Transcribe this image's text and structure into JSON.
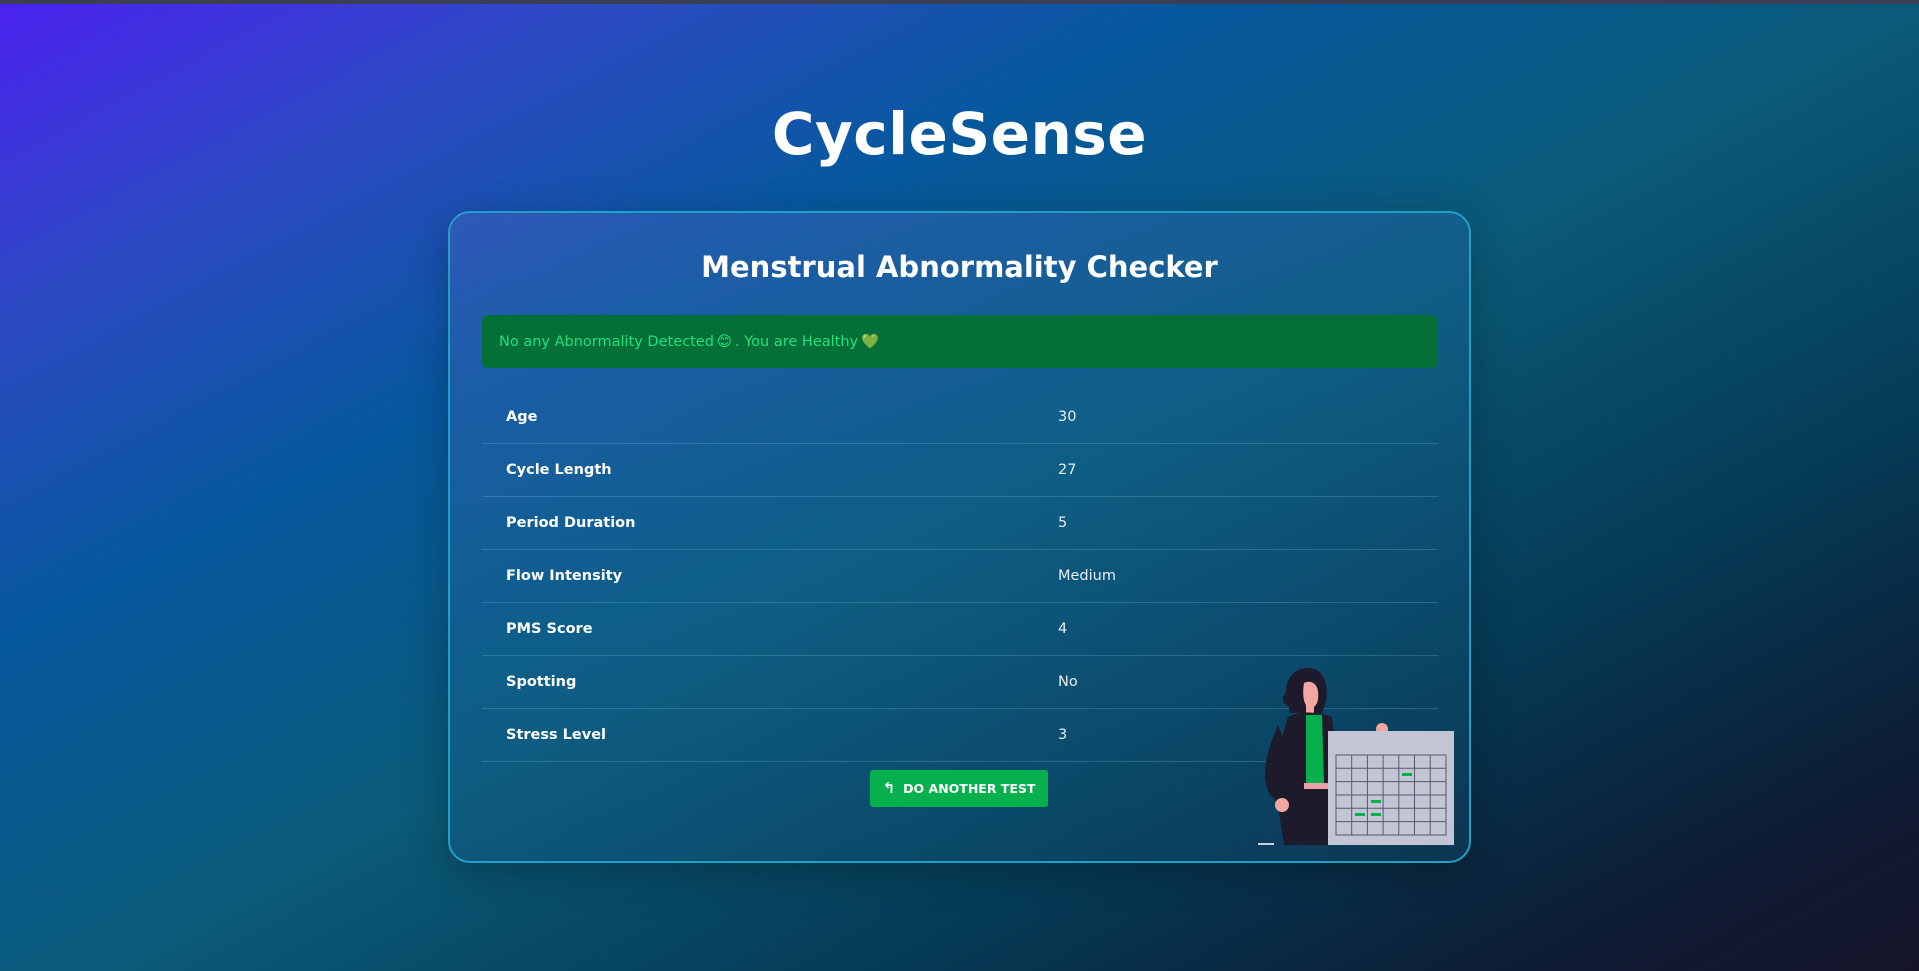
{
  "app": {
    "title": "CycleSense"
  },
  "card": {
    "title": "Menstrual Abnormality Checker",
    "alert": {
      "text_before": "No any Abnormality Detected",
      "emoji_smile": "😊",
      "text_middle": ". You are Healthy",
      "emoji_heart": "💚"
    },
    "rows": [
      {
        "label": "Age",
        "value": "30"
      },
      {
        "label": "Cycle Length",
        "value": "27"
      },
      {
        "label": "Period Duration",
        "value": "5"
      },
      {
        "label": "Flow Intensity",
        "value": "Medium"
      },
      {
        "label": "PMS Score",
        "value": "4"
      },
      {
        "label": "Spotting",
        "value": "No"
      },
      {
        "label": "Stress Level",
        "value": "3"
      }
    ],
    "button": {
      "label": "Do another test",
      "icon": "undo-arrow-icon"
    }
  },
  "colors": {
    "accent_green": "#06b04c",
    "alert_bg": "#047038",
    "alert_text": "#22e07a",
    "card_border": "#1fa0c8"
  },
  "illustration": {
    "name": "woman-with-calendar-illustration"
  }
}
